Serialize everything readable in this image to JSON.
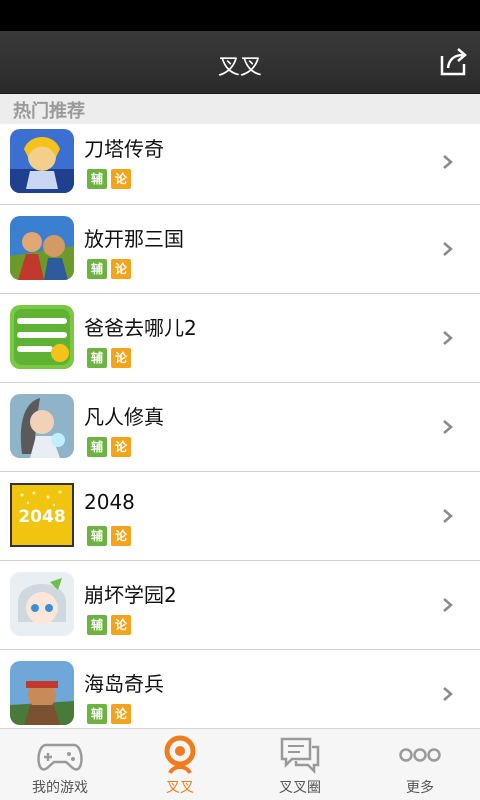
{
  "header": {
    "title": "叉叉"
  },
  "section": {
    "title": "热门推荐"
  },
  "games": [
    {
      "name": "刀塔传奇",
      "tags": [
        "辅",
        "论"
      ]
    },
    {
      "name": "放开那三国",
      "tags": [
        "辅",
        "论"
      ]
    },
    {
      "name": "爸爸去哪儿2",
      "tags": [
        "辅",
        "论"
      ]
    },
    {
      "name": "凡人修真",
      "tags": [
        "辅",
        "论"
      ]
    },
    {
      "name": "2048",
      "tags": [
        "辅",
        "论"
      ],
      "icon_text": "2048"
    },
    {
      "name": "崩坏学园2",
      "tags": [
        "辅",
        "论"
      ]
    },
    {
      "name": "海岛奇兵",
      "tags": [
        "辅",
        "论"
      ]
    }
  ],
  "tabs": [
    {
      "label": "我的游戏",
      "icon": "gamepad-icon"
    },
    {
      "label": "叉叉",
      "icon": "xx-logo-icon",
      "active": true
    },
    {
      "label": "叉叉圈",
      "icon": "chat-bubbles-icon"
    },
    {
      "label": "更多",
      "icon": "more-dots-icon"
    }
  ],
  "colors": {
    "accent": "#f07c1e",
    "tag_green": "#6db33f",
    "tag_orange": "#f3a41b",
    "header_bg": "#2f2f2f"
  }
}
